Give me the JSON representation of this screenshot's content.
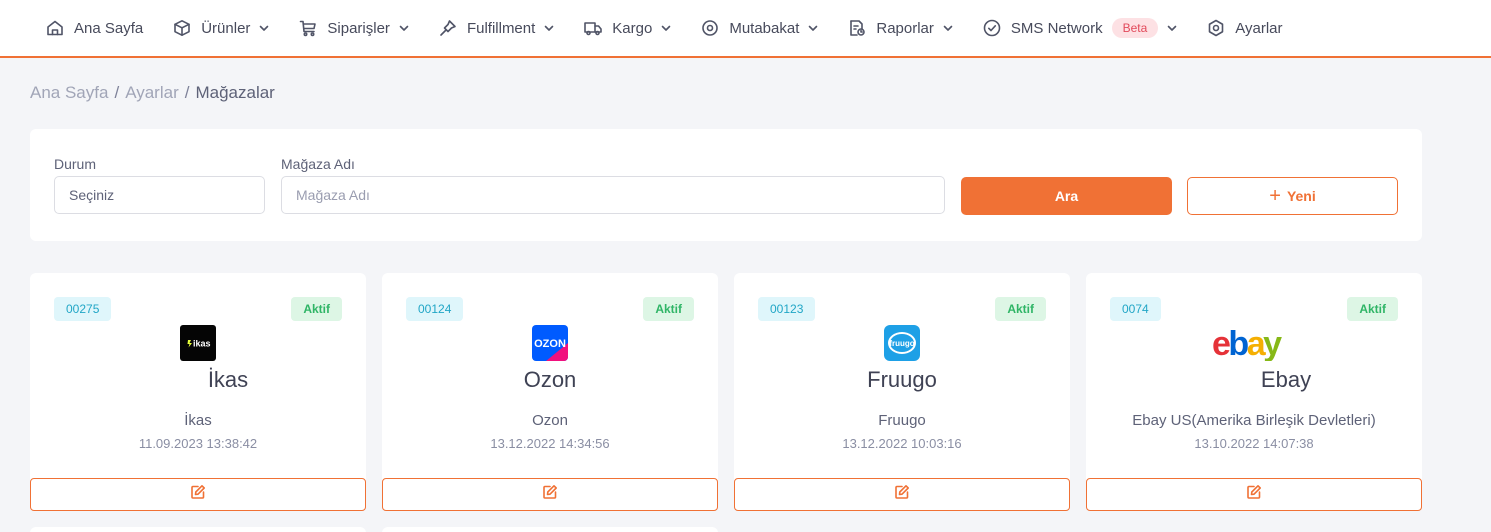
{
  "nav": {
    "items": [
      {
        "label": "Ana Sayfa",
        "icon": "home-icon",
        "dropdown": false
      },
      {
        "label": "Ürünler",
        "icon": "box-icon",
        "dropdown": true
      },
      {
        "label": "Siparişler",
        "icon": "cart-icon",
        "dropdown": true
      },
      {
        "label": "Fulfillment",
        "icon": "pin-icon",
        "dropdown": true
      },
      {
        "label": "Kargo",
        "icon": "truck-icon",
        "dropdown": true
      },
      {
        "label": "Mutabakat",
        "icon": "target-icon",
        "dropdown": true
      },
      {
        "label": "Raporlar",
        "icon": "report-icon",
        "dropdown": true
      },
      {
        "label": "SMS Network",
        "icon": "check-circle-icon",
        "dropdown": true,
        "badge": "Beta"
      },
      {
        "label": "Ayarlar",
        "icon": "settings-icon",
        "dropdown": false
      }
    ],
    "accent": "#f07135"
  },
  "breadcrumb": {
    "items": [
      "Ana Sayfa",
      "Ayarlar"
    ],
    "current": "Mağazalar",
    "separator": "/"
  },
  "filter": {
    "status_label": "Durum",
    "status_value": "Seçiniz",
    "name_label": "Mağaza Adı",
    "name_placeholder": "Mağaza Adı",
    "search_button": "Ara",
    "new_button": "Yeni"
  },
  "stores": [
    {
      "code": "00275",
      "status": "Aktif",
      "name": "İkas",
      "description": "İkas",
      "date": "11.09.2023 13:38:42",
      "logo": "ikas-logo",
      "logo_text": "ikas"
    },
    {
      "code": "00124",
      "status": "Aktif",
      "name": "Ozon",
      "description": "Ozon",
      "date": "13.12.2022 14:34:56",
      "logo": "ozon-logo",
      "logo_text": "OZON"
    },
    {
      "code": "00123",
      "status": "Aktif",
      "name": "Fruugo",
      "description": "Fruugo",
      "date": "13.12.2022 10:03:16",
      "logo": "fruugo-logo",
      "logo_text": "fruugo"
    },
    {
      "code": "0074",
      "status": "Aktif",
      "name": "Ebay",
      "description": "Ebay US(Amerika Birleşik Devletleri)",
      "date": "13.10.2022 14:07:38",
      "logo": "ebay-logo",
      "logo_text": "ebay"
    }
  ],
  "colors": {
    "code_badge_bg": "#dff6fb",
    "code_badge_text": "#21a6c6",
    "status_badge_bg": "#ddf6e5",
    "status_badge_text": "#2fb566"
  }
}
